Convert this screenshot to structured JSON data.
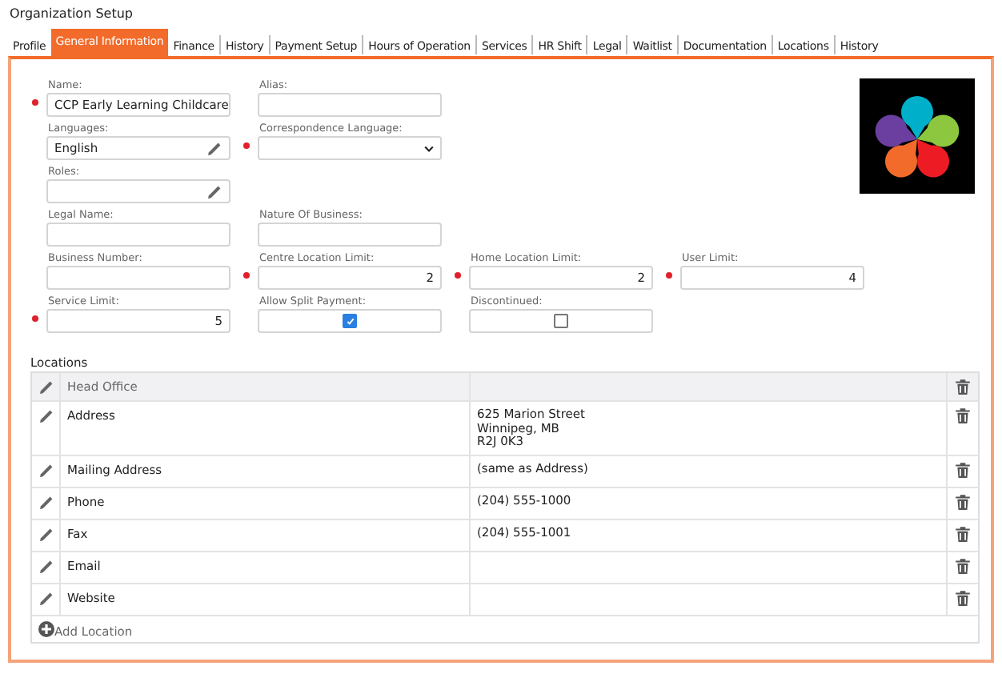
{
  "page_title": "Organization Setup",
  "tabs": [
    {
      "label": "Profile",
      "selected": false
    },
    {
      "label": "General Information",
      "selected": true
    },
    {
      "label": "Finance",
      "selected": false
    },
    {
      "label": "History",
      "selected": false
    },
    {
      "label": "Payment Setup",
      "selected": false
    },
    {
      "label": "Hours of Operation",
      "selected": false
    },
    {
      "label": "Services",
      "selected": false
    },
    {
      "label": "HR Shift",
      "selected": false
    },
    {
      "label": "Legal",
      "selected": false
    },
    {
      "label": "Waitlist",
      "selected": false
    },
    {
      "label": "Documentation",
      "selected": false
    },
    {
      "label": "Locations",
      "selected": false
    },
    {
      "label": "History",
      "selected": false
    }
  ],
  "form_rows": [
    [
      {
        "label": "Name:",
        "kind": "text",
        "value": "CCP Early Learning Childcare",
        "required": true
      },
      {
        "label": "Alias:",
        "kind": "text",
        "required": false
      }
    ],
    [
      {
        "label": "Languages:",
        "kind": "picker",
        "value": "English",
        "required": false
      },
      {
        "label": "Correspondence Language:",
        "kind": "select",
        "required": true
      }
    ],
    [
      {
        "label": "Roles:",
        "kind": "picker",
        "required": false
      }
    ],
    [
      {
        "label": "Legal Name:",
        "kind": "text",
        "required": false
      },
      {
        "label": "Nature Of Business:",
        "kind": "text",
        "required": false
      }
    ],
    [
      {
        "label": "Business Number:",
        "kind": "text",
        "required": false
      },
      {
        "label": "Centre Location Limit:",
        "kind": "number",
        "value": "2",
        "required": true
      },
      {
        "label": "Home Location Limit:",
        "kind": "number",
        "value": "2",
        "required": true
      },
      {
        "label": "User Limit:",
        "kind": "number",
        "value": "4",
        "required": true
      }
    ],
    [
      {
        "label": "Service Limit:",
        "kind": "number",
        "value": "5",
        "required": true
      },
      {
        "label": "Allow Split Payment:",
        "kind": "checkbox",
        "checked": true,
        "required": false
      },
      {
        "label": "Discontinued:",
        "kind": "checkbox",
        "checked": false,
        "required": false
      }
    ]
  ],
  "locations": {
    "title": "Locations",
    "header": "Head Office",
    "rows": [
      {
        "field": "Address",
        "lines": [
          "625 Marion Street",
          "Winnipeg, MB",
          "R2J 0K3"
        ]
      },
      {
        "field": "Mailing Address",
        "lines": [
          "(same as Address)"
        ]
      },
      {
        "field": "Phone",
        "lines": [
          "(204) 555-1000"
        ]
      },
      {
        "field": "Fax",
        "lines": [
          "(204) 555-1001"
        ]
      },
      {
        "field": "Email",
        "lines": []
      },
      {
        "field": "Website",
        "lines": []
      }
    ],
    "add_label": "Add Location"
  }
}
